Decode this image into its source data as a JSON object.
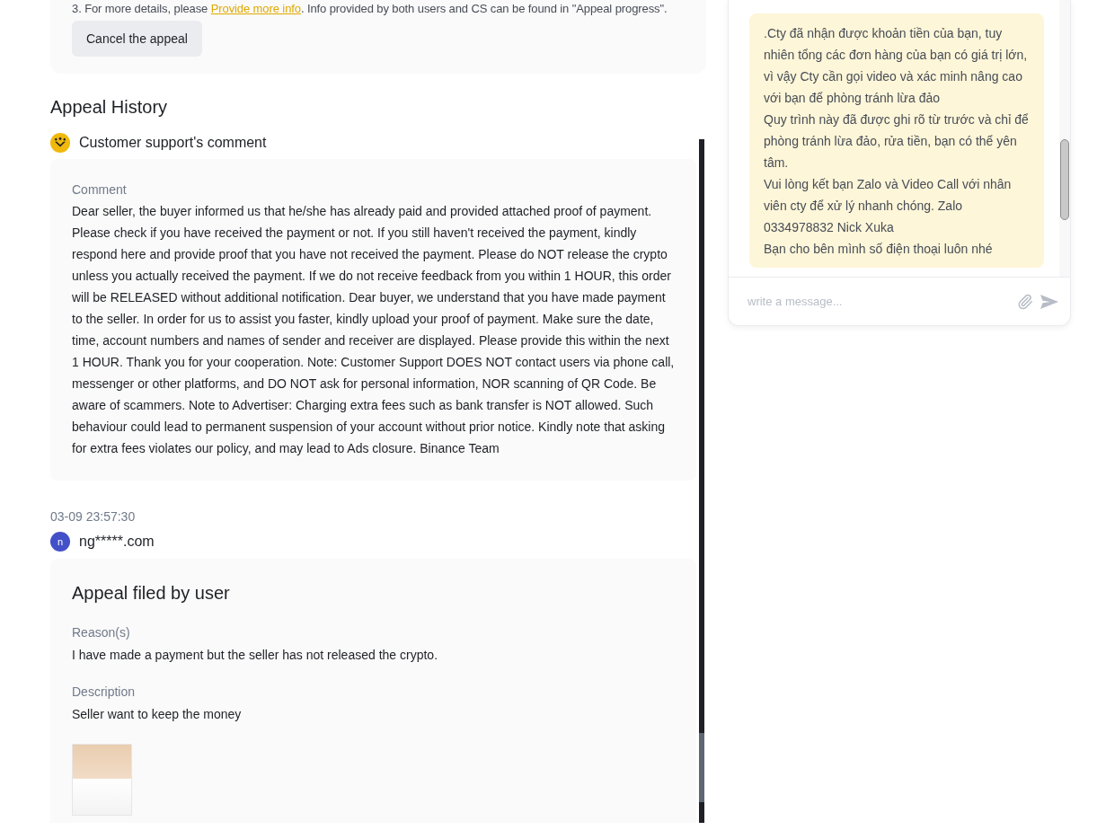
{
  "appeal_notice": {
    "prefix": "3. For more details, please ",
    "link": "Provide more info",
    "suffix": ". Info provided by both users and CS can be found in \"Appeal progress\"."
  },
  "cancel_button": "Cancel the appeal",
  "appeal_history": {
    "title": "Appeal History",
    "entries": [
      {
        "kind": "support_comment",
        "author": "Customer support's comment",
        "label": "Comment",
        "text": "Dear seller, the buyer informed us that he/she has already paid and provided attached proof of payment. Please check if you have received the payment or not. If you still haven't received the payment, kindly respond here and provide proof that you have not received the payment. Please do NOT release the crypto unless you actually received the payment. If we do not receive feedback from you within 1 HOUR, this order will be RELEASED without additional notification. Dear buyer, we understand that you have made payment to the seller. In order for us to assist you faster, kindly upload your proof of payment. Make sure the date, time, account numbers and names of sender and receiver are displayed. Please provide this within the next 1 HOUR. Thank you for your cooperation. Note: Customer Support DOES NOT contact users via phone call, messenger or other platforms, and DO NOT ask for personal information, NOR scanning of QR Code. Be aware of scammers. Note to Advertiser: Charging extra fees such as bank transfer is NOT allowed. Such behaviour could lead to permanent suspension of your account without prior notice. Kindly note that asking for extra fees violates our policy, and may lead to Ads closure. Binance Team"
      },
      {
        "kind": "user_appeal",
        "timestamp": "03-09 23:57:30",
        "avatar_letter": "n",
        "author": "ng*****.com",
        "title": "Appeal filed by user",
        "fields": [
          {
            "label": "Reason(s)",
            "value": "I have made a payment but the seller has not released the crypto."
          },
          {
            "label": "Description",
            "value": "Seller want to keep the money"
          }
        ],
        "attachments": [
          {
            "kind": "image"
          }
        ]
      }
    ]
  },
  "chat": {
    "messages": [
      {
        "text": ".Cty đã nhận được khoản tiền của bạn, tuy nhiên tổng các đơn hàng của bạn có giá trị lớn, vì vậy Cty cần gọi video và xác minh nâng cao với bạn để phòng tránh lừa đảo\nQuy trình này đã được ghi rõ từ trước và chỉ để phòng tránh lừa đảo, rửa tiền, bạn có thể yên tâm.\nVui lòng kết bạn Zalo và Video Call với nhân viên cty để xử lý nhanh chóng. Zalo 0334978832 Nick Xuka\nBạn cho bên mình số điện thoại luôn nhé"
      }
    ],
    "input": {
      "placeholder": "write a message..."
    }
  }
}
